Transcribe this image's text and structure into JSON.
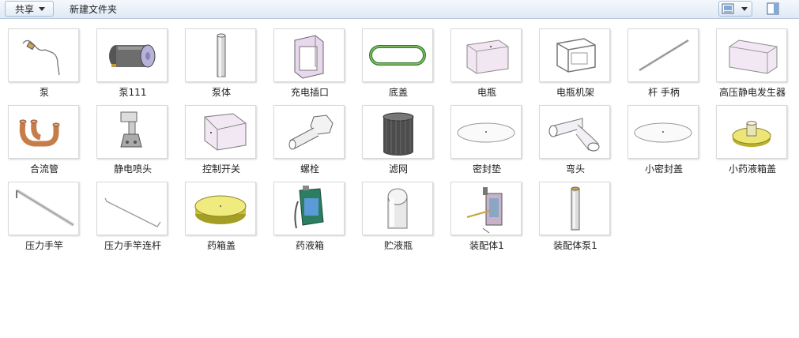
{
  "toolbar": {
    "share_label": "共享",
    "new_folder_label": "新建文件夹"
  },
  "files": [
    {
      "name": "泵",
      "icon": "bent-wire-pump-icon"
    },
    {
      "name": "泵111",
      "icon": "motor-cylinder-icon"
    },
    {
      "name": "泵体",
      "icon": "vertical-cylinder-icon"
    },
    {
      "name": "充电插口",
      "icon": "open-box-frame-icon"
    },
    {
      "name": "底盖",
      "icon": "green-belt-icon"
    },
    {
      "name": "电瓶",
      "icon": "battery-box-icon"
    },
    {
      "name": "电瓶机架",
      "icon": "wire-rack-icon"
    },
    {
      "name": "杆 手柄",
      "icon": "thin-rod-icon"
    },
    {
      "name": "高压静电发生器",
      "icon": "flat-box-icon"
    },
    {
      "name": "合流管",
      "icon": "copper-pipe-icon"
    },
    {
      "name": "静电喷头",
      "icon": "nozzle-icon"
    },
    {
      "name": "控制开关",
      "icon": "wedge-block-icon"
    },
    {
      "name": "螺栓",
      "icon": "bolt-icon"
    },
    {
      "name": "滤网",
      "icon": "mesh-cylinder-icon"
    },
    {
      "name": "密封垫",
      "icon": "flat-disc-icon"
    },
    {
      "name": "弯头",
      "icon": "elbow-pipe-icon"
    },
    {
      "name": "小密封盖",
      "icon": "flat-disc-icon"
    },
    {
      "name": "小药液箱盖",
      "icon": "yellow-cap-knob-icon"
    },
    {
      "name": "压力手竿",
      "icon": "long-rod-icon"
    },
    {
      "name": "压力手竿连杆",
      "icon": "bent-rod-icon"
    },
    {
      "name": "药箱盖",
      "icon": "yellow-lid-icon"
    },
    {
      "name": "药液箱",
      "icon": "green-tank-icon"
    },
    {
      "name": "贮液瓶",
      "icon": "capsule-bottle-icon"
    },
    {
      "name": "装配体1",
      "icon": "assembly-icon"
    },
    {
      "name": "装配体泵1",
      "icon": "pump-tube-icon"
    }
  ]
}
